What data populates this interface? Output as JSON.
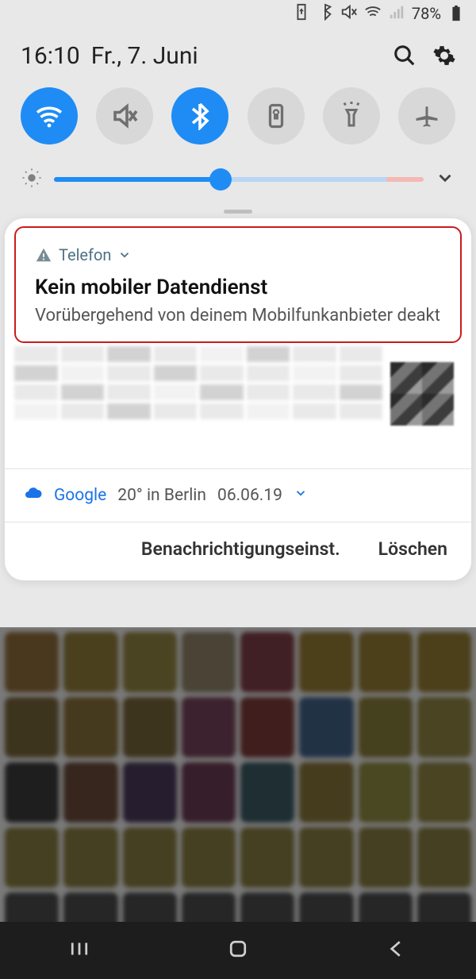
{
  "status": {
    "battery_pct": "78%"
  },
  "header": {
    "time": "16:10",
    "date": "Fr., 7. Juni"
  },
  "qs": {
    "wifi": "wifi",
    "mute": "mute",
    "bluetooth": "bluetooth",
    "rotation": "rotation-lock",
    "flashlight": "flashlight",
    "airplane": "airplane"
  },
  "brightness": {
    "value_pct": 45
  },
  "notifications": {
    "phone": {
      "app": "Telefon",
      "title": "Kein mobiler Datendienst",
      "body": "Vorübergehend von deinem Mobilfunkanbieter deakt.."
    },
    "google": {
      "label": "Google",
      "temp": "20° in Berlin",
      "date": "06.06.19"
    }
  },
  "footer": {
    "settings": "Benachrichtigungseinst.",
    "clear": "Löschen"
  }
}
